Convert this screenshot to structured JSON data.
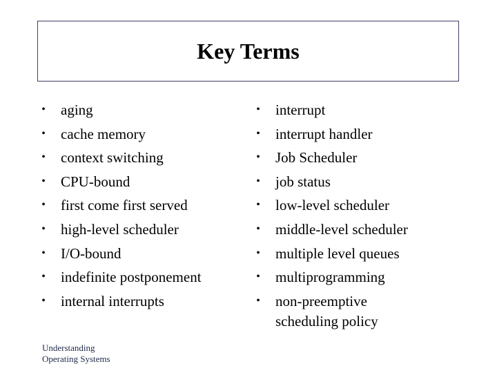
{
  "slide": {
    "title": "Key Terms",
    "left_terms": [
      "aging",
      "cache memory",
      "context switching",
      "CPU-bound",
      "first come first served",
      "high-level scheduler",
      "I/O-bound",
      "indefinite postponement",
      "internal interrupts"
    ],
    "right_terms": [
      "interrupt",
      "interrupt handler",
      "Job Scheduler",
      "job status",
      "low-level scheduler",
      "middle-level scheduler",
      "multiple level queues",
      "multiprogramming",
      "non-preemptive scheduling policy"
    ],
    "bullet_glyph": "•",
    "footer": {
      "line1": "Understanding",
      "line2": "Operating Systems"
    },
    "colors": {
      "title_border": "#3f3f66",
      "footer_text": "#1f2a4a"
    }
  }
}
